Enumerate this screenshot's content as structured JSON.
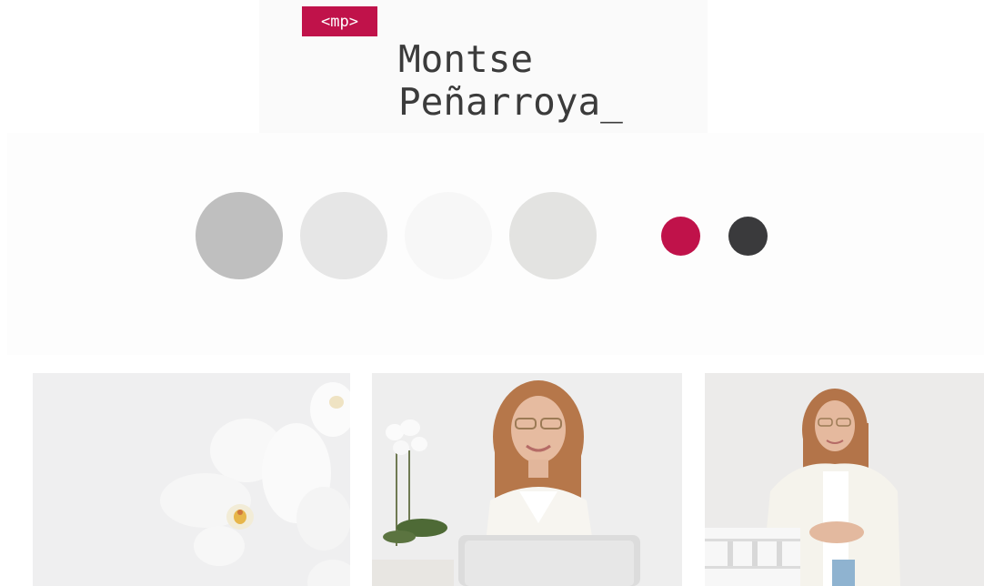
{
  "logo": {
    "badge": "<mp>",
    "name_line1": "Montse",
    "name_line2": "Peñarroya_",
    "badge_color": "#c0124a"
  },
  "palette": {
    "colors": [
      "#bfbfbf",
      "#e6e6e6",
      "#f7f7f7",
      "#e3e3e1",
      "#c0124a",
      "#3a3a3c"
    ]
  },
  "photos": [
    {
      "name": "white-orchid-photo"
    },
    {
      "name": "woman-at-laptop-photo"
    },
    {
      "name": "woman-standing-photo"
    }
  ]
}
